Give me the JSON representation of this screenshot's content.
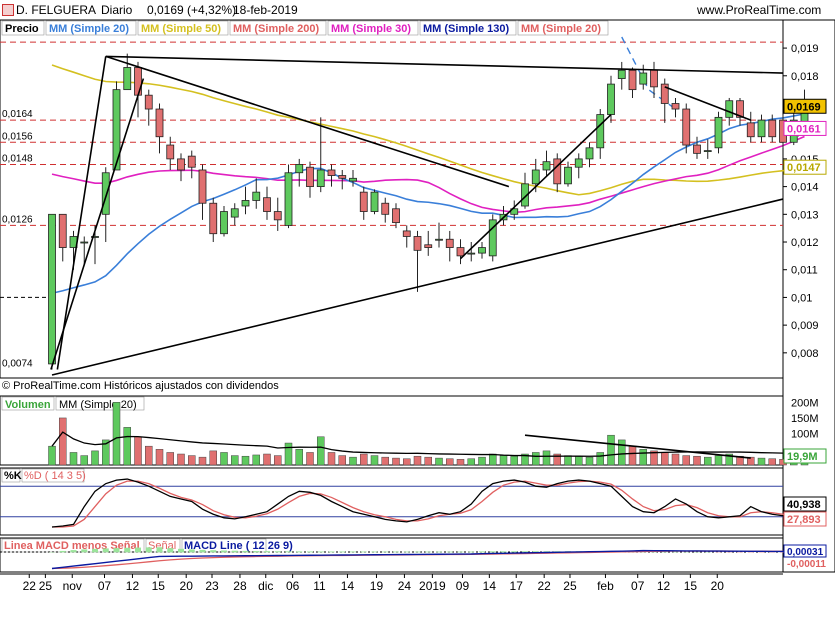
{
  "header": {
    "symbol": "D. FELGUERA",
    "period": "Diario",
    "last": "0,0169 (+4,32%)",
    "date": "18-feb-2019",
    "site": "www.ProRealTime.com"
  },
  "price_panel": {
    "label": "Precio",
    "legend": [
      {
        "text": "MM (Simple 20)",
        "color": "#3a7fd9"
      },
      {
        "text": "MM (Simple 50)",
        "color": "#d4c020"
      },
      {
        "text": "MM (Simple 200)",
        "color": "#e06060"
      },
      {
        "text": "MM (Simple 30)",
        "color": "#e020c0"
      },
      {
        "text": "MM (Simple 130)",
        "color": "#0a1aa0"
      },
      {
        "text": "MM (Simple 20)",
        "color": "#e06060"
      }
    ],
    "copyright": "© ProRealTime.com  Históricos ajustados con dividendos",
    "left_levels": [
      {
        "label": "0,0164",
        "value": 0.0164
      },
      {
        "label": "0,0156",
        "value": 0.0156
      },
      {
        "label": "0,0148",
        "value": 0.0148
      },
      {
        "label": "0,0126",
        "value": 0.0126
      },
      {
        "label": "0,0074",
        "value": 0.0074
      }
    ],
    "right_ticks": [
      {
        "label": "0,019",
        "value": 0.019
      },
      {
        "label": "0,018",
        "value": 0.018
      },
      {
        "label": "0,016",
        "value": 0.016
      },
      {
        "label": "0,015",
        "value": 0.015
      },
      {
        "label": "0,014",
        "value": 0.014
      },
      {
        "label": "0,013",
        "value": 0.013
      },
      {
        "label": "0,012",
        "value": 0.012
      },
      {
        "label": "0,011",
        "value": 0.011
      },
      {
        "label": "0,01",
        "value": 0.01
      },
      {
        "label": "0,009",
        "value": 0.009
      },
      {
        "label": "0,008",
        "value": 0.008
      }
    ],
    "badges": [
      {
        "label": "0,0169",
        "value": 0.0169,
        "bg": "#f2c200",
        "fg": "#000000"
      },
      {
        "label": "0,0161",
        "value": 0.0161,
        "bg": "#ffffff",
        "fg": "#e020c0"
      },
      {
        "label": "0,0147",
        "value": 0.0147,
        "bg": "#ffffff",
        "fg": "#b8a800"
      }
    ]
  },
  "volume_panel": {
    "label": "Volumen",
    "legend": "MM (Simple 20)",
    "ticks": [
      {
        "label": "200M",
        "value": 200
      },
      {
        "label": "150M",
        "value": 150
      },
      {
        "label": "100M",
        "value": 100
      }
    ],
    "badge": "19,9M"
  },
  "stoch_panel": {
    "label_k": "%K",
    "label_d": "%D ( 14 3 5)",
    "badge_k": "40,938",
    "badge_d": "27,893"
  },
  "macd_panel": {
    "label_hist": "Linea MACD menos Señal",
    "label_signal": "Señal",
    "label_line": "MACD Line ( 12 26 9)",
    "badge_line": "0,00031",
    "badge_signal": "-0,00011"
  },
  "x_axis": [
    {
      "label": "22",
      "i": -1
    },
    {
      "label": "25",
      "i": 0.5
    },
    {
      "label": "nov",
      "i": 3
    },
    {
      "label": "07",
      "i": 6
    },
    {
      "label": "12",
      "i": 8.6
    },
    {
      "label": "15",
      "i": 11
    },
    {
      "label": "20",
      "i": 13.6
    },
    {
      "label": "23",
      "i": 16
    },
    {
      "label": "28",
      "i": 18.6
    },
    {
      "label": "dic",
      "i": 21
    },
    {
      "label": "06",
      "i": 23.5
    },
    {
      "label": "11",
      "i": 26
    },
    {
      "label": "14",
      "i": 28.6
    },
    {
      "label": "19",
      "i": 31.3
    },
    {
      "label": "24",
      "i": 33.9
    },
    {
      "label": "2019",
      "i": 36.5
    },
    {
      "label": "09",
      "i": 39.3
    },
    {
      "label": "14",
      "i": 41.8
    },
    {
      "label": "17",
      "i": 44.3
    },
    {
      "label": "22",
      "i": 46.9
    },
    {
      "label": "25",
      "i": 49.3
    },
    {
      "label": "feb",
      "i": 52.6
    },
    {
      "label": "07",
      "i": 55.6
    },
    {
      "label": "12",
      "i": 58
    },
    {
      "label": "15",
      "i": 60.5
    },
    {
      "label": "20",
      "i": 63
    }
  ],
  "chart_data": {
    "type": "candlestick",
    "ylim": [
      0.0072,
      0.0194
    ],
    "candles": [
      [
        0.0076,
        0.013,
        0.0074,
        0.0076
      ],
      [
        0.013,
        0.0118,
        0.0113,
        0.013
      ],
      [
        0.0118,
        0.0122,
        0.011,
        0.0124
      ],
      [
        0.012,
        0.012,
        0.0112,
        0.0122
      ],
      [
        0.0122,
        0.0122,
        0.0112,
        0.0126
      ],
      [
        0.013,
        0.0145,
        0.012,
        0.0147
      ],
      [
        0.0146,
        0.0175,
        0.0146,
        0.0178
      ],
      [
        0.0175,
        0.0183,
        0.0175,
        0.0188
      ],
      [
        0.0183,
        0.0173,
        0.0165,
        0.0185
      ],
      [
        0.0173,
        0.0168,
        0.0162,
        0.0175
      ],
      [
        0.0168,
        0.0158,
        0.0152,
        0.017
      ],
      [
        0.0155,
        0.015,
        0.0146,
        0.0158
      ],
      [
        0.015,
        0.0146,
        0.0142,
        0.0152
      ],
      [
        0.0151,
        0.0147,
        0.0143,
        0.0153
      ],
      [
        0.0146,
        0.0134,
        0.0128,
        0.0148
      ],
      [
        0.0134,
        0.0123,
        0.012,
        0.0136
      ],
      [
        0.0123,
        0.0131,
        0.0122,
        0.0133
      ],
      [
        0.0129,
        0.0132,
        0.0126,
        0.0134
      ],
      [
        0.0133,
        0.0135,
        0.013,
        0.014
      ],
      [
        0.0135,
        0.0138,
        0.0132,
        0.0143
      ],
      [
        0.0136,
        0.0131,
        0.0128,
        0.014
      ],
      [
        0.0131,
        0.0128,
        0.0124,
        0.0136
      ],
      [
        0.0126,
        0.0145,
        0.0125,
        0.0148
      ],
      [
        0.0145,
        0.0148,
        0.014,
        0.015
      ],
      [
        0.0147,
        0.014,
        0.0136,
        0.0149
      ],
      [
        0.014,
        0.0146,
        0.0138,
        0.0165
      ],
      [
        0.0146,
        0.0144,
        0.014,
        0.0148
      ],
      [
        0.0144,
        0.0143,
        0.0139,
        0.0146
      ],
      [
        0.0142,
        0.0143,
        0.014,
        0.0146
      ],
      [
        0.0138,
        0.0131,
        0.0128,
        0.014
      ],
      [
        0.0131,
        0.0138,
        0.013,
        0.0139
      ],
      [
        0.0134,
        0.013,
        0.0127,
        0.0136
      ],
      [
        0.0132,
        0.0127,
        0.0125,
        0.0134
      ],
      [
        0.0124,
        0.0122,
        0.0118,
        0.0126
      ],
      [
        0.0122,
        0.0117,
        0.0102,
        0.0124
      ],
      [
        0.0119,
        0.0118,
        0.0115,
        0.0124
      ],
      [
        0.0121,
        0.0121,
        0.0118,
        0.0127
      ],
      [
        0.0121,
        0.0118,
        0.0113,
        0.0124
      ],
      [
        0.0118,
        0.0115,
        0.0112,
        0.0121
      ],
      [
        0.0116,
        0.0116,
        0.0113,
        0.012
      ],
      [
        0.0116,
        0.0118,
        0.0114,
        0.012
      ],
      [
        0.0115,
        0.0128,
        0.0113,
        0.013
      ],
      [
        0.0128,
        0.013,
        0.0126,
        0.0133
      ],
      [
        0.013,
        0.0132,
        0.0128,
        0.0135
      ],
      [
        0.0133,
        0.0141,
        0.0132,
        0.0145
      ],
      [
        0.0141,
        0.0146,
        0.0138,
        0.015
      ],
      [
        0.0146,
        0.0149,
        0.0144,
        0.0153
      ],
      [
        0.015,
        0.0141,
        0.0138,
        0.0152
      ],
      [
        0.0141,
        0.0147,
        0.014,
        0.0149
      ],
      [
        0.0147,
        0.015,
        0.0143,
        0.0152
      ],
      [
        0.015,
        0.0154,
        0.0147,
        0.0156
      ],
      [
        0.0154,
        0.0166,
        0.015,
        0.0168
      ],
      [
        0.0166,
        0.0177,
        0.0163,
        0.018
      ],
      [
        0.0179,
        0.0182,
        0.0175,
        0.0185
      ],
      [
        0.0182,
        0.0175,
        0.0172,
        0.0183
      ],
      [
        0.0177,
        0.0181,
        0.0175,
        0.0184
      ],
      [
        0.0182,
        0.0176,
        0.0172,
        0.0185
      ],
      [
        0.0177,
        0.017,
        0.0163,
        0.0179
      ],
      [
        0.017,
        0.0168,
        0.0165,
        0.0172
      ],
      [
        0.0168,
        0.0155,
        0.0152,
        0.017
      ],
      [
        0.0155,
        0.0152,
        0.015,
        0.0158
      ],
      [
        0.0153,
        0.0153,
        0.015,
        0.0157
      ],
      [
        0.0154,
        0.0165,
        0.0152,
        0.0167
      ],
      [
        0.0165,
        0.0171,
        0.0162,
        0.0172
      ],
      [
        0.0171,
        0.0165,
        0.0162,
        0.0172
      ],
      [
        0.0163,
        0.0158,
        0.0156,
        0.0167
      ],
      [
        0.0158,
        0.0164,
        0.0156,
        0.0166
      ],
      [
        0.0164,
        0.0158,
        0.0156,
        0.0166
      ],
      [
        0.0164,
        0.0156,
        0.0154,
        0.0166
      ],
      [
        0.0156,
        0.0164,
        0.0155,
        0.0167
      ],
      [
        0.0162,
        0.0169,
        0.0161,
        0.0175
      ]
    ],
    "volume": [
      60,
      150,
      40,
      30,
      45,
      80,
      200,
      120,
      90,
      60,
      50,
      40,
      35,
      30,
      25,
      45,
      40,
      30,
      28,
      32,
      35,
      30,
      70,
      50,
      40,
      90,
      40,
      30,
      25,
      35,
      30,
      25,
      22,
      20,
      28,
      25,
      22,
      20,
      18,
      20,
      25,
      35,
      30,
      28,
      35,
      40,
      45,
      35,
      30,
      28,
      25,
      40,
      95,
      80,
      60,
      50,
      45,
      40,
      35,
      30,
      28,
      25,
      30,
      35,
      28,
      25,
      22,
      20,
      18,
      20,
      19.9
    ]
  }
}
